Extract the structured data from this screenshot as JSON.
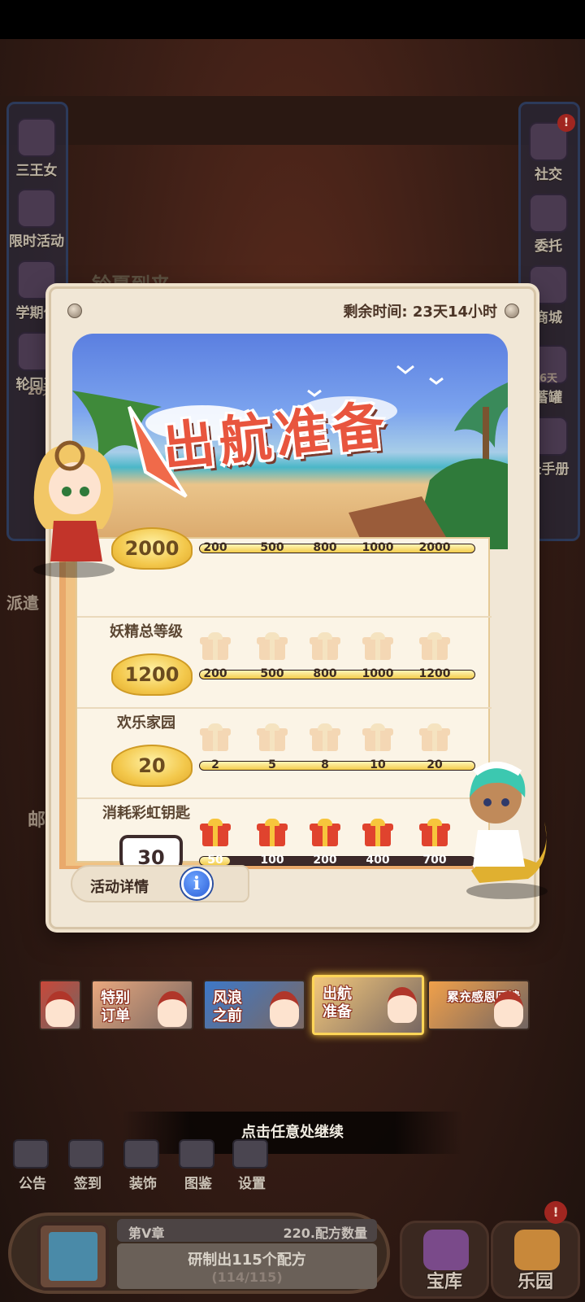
{
  "left_menu": [
    {
      "label": "三王女",
      "icon": "witch-icon"
    },
    {
      "label": "限时活动",
      "icon": "timed-event-icon"
    },
    {
      "label": "学期作",
      "icon": "semester-icon"
    },
    {
      "label": "轮回召",
      "icon": "summon-icon"
    }
  ],
  "left_extras": {
    "timer": "20天0",
    "dispatch": "派遣",
    "mail": "邮"
  },
  "right_menu": [
    {
      "label": "社交",
      "icon": "social-icon"
    },
    {
      "label": "委托",
      "icon": "commission-icon"
    },
    {
      "label": "商城",
      "icon": "shop-icon"
    },
    {
      "label": "蓄罐",
      "icon": "piggy-icon"
    },
    {
      "label": "长手册",
      "icon": "handbook-icon"
    }
  ],
  "right_extras": {
    "timer": "6天",
    "badge": "!"
  },
  "scene_text": "铃夏到来",
  "modal": {
    "remaining_time": "剩余时间: 23天14小时",
    "banner_title": "出航准备",
    "rows": [
      {
        "label": "",
        "value": "2000",
        "badge_style": "laurel",
        "progress": 1.0,
        "gifts": "none",
        "ticks": [
          "200",
          "500",
          "800",
          "1000",
          "2000"
        ]
      },
      {
        "label": "妖精总等级",
        "value": "1200",
        "badge_style": "laurel",
        "progress": 1.0,
        "gifts": "faded",
        "ticks": [
          "200",
          "500",
          "800",
          "1000",
          "1200"
        ]
      },
      {
        "label": "欢乐家园",
        "value": "20",
        "badge_style": "laurel",
        "progress": 1.0,
        "gifts": "faded",
        "ticks": [
          "2",
          "5",
          "8",
          "10",
          "20"
        ]
      },
      {
        "label": "消耗彩虹钥匙",
        "value": "30",
        "badge_style": "plain",
        "progress": 0.11,
        "gifts": "red",
        "ticks": [
          "50",
          "100",
          "200",
          "400",
          "700"
        ]
      }
    ],
    "details_label": "活动详情",
    "info_icon_glyph": "i"
  },
  "carousel": [
    {
      "label": "",
      "bg": "#c9483a"
    },
    {
      "label": "特别订单",
      "bg": "#e9a87e"
    },
    {
      "label": "风浪之前",
      "bg": "#3d78c8"
    },
    {
      "label": "出航准备",
      "bg": "#f2c77a",
      "active": true
    },
    {
      "label": "累充感恩回馈",
      "bg": "#f0a04a"
    }
  ],
  "continue_text": "点击任意处继续",
  "bottom_menu": [
    {
      "label": "公告",
      "icon": "notice-icon"
    },
    {
      "label": "签到",
      "icon": "calendar-icon"
    },
    {
      "label": "装饰",
      "icon": "decoration-icon"
    },
    {
      "label": "图鉴",
      "icon": "collection-icon"
    },
    {
      "label": "设置",
      "icon": "settings-icon"
    }
  ],
  "book_panel": {
    "chapter": "第V章",
    "recipe_count": "220.配方数量",
    "task": "研制出115个配方",
    "progress_text": "(114/115)"
  },
  "bottom_buttons": [
    {
      "label": "宝库",
      "icon": "treasury-icon"
    },
    {
      "label": "乐园",
      "icon": "paradise-icon",
      "alert": "!"
    }
  ]
}
